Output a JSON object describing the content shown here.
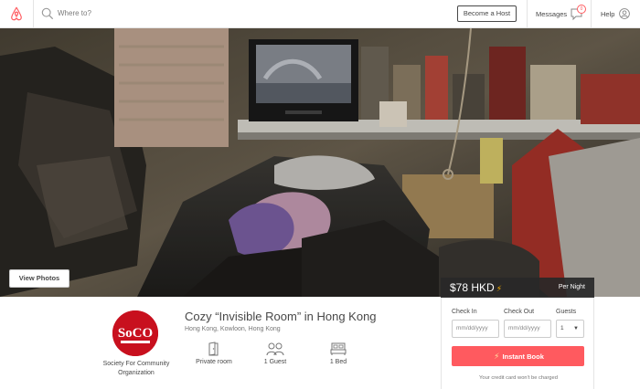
{
  "header": {
    "search_placeholder": "Where to?",
    "become_host": "Become a Host",
    "messages": "Messages",
    "messages_count": "0",
    "help": "Help"
  },
  "hero": {
    "view_photos": "View Photos"
  },
  "listing": {
    "title": "Cozy “Invisible Room” in Hong Kong",
    "location": "Hong Kong, Kowloon, Hong Kong",
    "host_name": "Society For Community Organization",
    "host_logo_text": "SoCO",
    "amenities": [
      {
        "icon": "door-icon",
        "label": "Private room"
      },
      {
        "icon": "guests-icon",
        "label": "1 Guest"
      },
      {
        "icon": "bed-icon",
        "label": "1 Bed"
      }
    ]
  },
  "booking": {
    "price": "$78 HKD",
    "per_night": "Per Night",
    "check_in_label": "Check In",
    "check_out_label": "Check Out",
    "guests_label": "Guests",
    "date_placeholder": "mm/dd/yyyy",
    "guests_value": "1",
    "instant_book": "Instant Book",
    "note": "Your credit card won't be charged"
  },
  "colors": {
    "brand": "#ff5a5f",
    "instant_bolt": "#ffb400",
    "logo_red": "#c8101e"
  }
}
